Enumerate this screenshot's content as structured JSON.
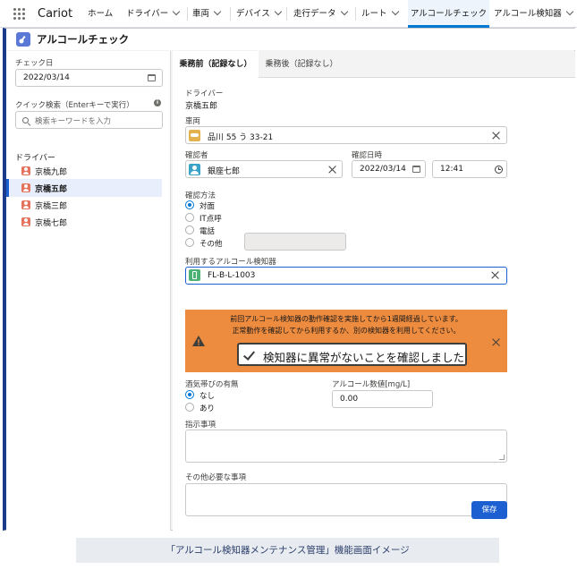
{
  "app": {
    "name": "Cariot"
  },
  "nav": {
    "tabs": [
      {
        "label": "ホーム"
      },
      {
        "label": "ドライバー"
      },
      {
        "label": "車両"
      },
      {
        "label": "デバイス"
      },
      {
        "label": "走行データ"
      },
      {
        "label": "ルート"
      },
      {
        "label": "アルコールチェック"
      },
      {
        "label": "アルコール検知器"
      }
    ],
    "active_tab": "アルコールチェック"
  },
  "page": {
    "title": "アルコールチェック"
  },
  "left": {
    "check_date_label": "チェック日",
    "check_date_value": "2022/03/14",
    "quick_search_label": "クイック検索（Enterキーで実行）",
    "search_placeholder": "検索キーワードを入力",
    "drivers_label": "ドライバー",
    "drivers": [
      {
        "name": "京橋九郎",
        "selected": false
      },
      {
        "name": "京橋五郎",
        "selected": true
      },
      {
        "name": "京橋三郎",
        "selected": false
      },
      {
        "name": "京橋七郎",
        "selected": false
      }
    ]
  },
  "main": {
    "tabs": [
      {
        "label": "乗務前（記録なし）",
        "active": true
      },
      {
        "label": "乗務後（記録なし）",
        "active": false
      }
    ],
    "driver_label": "ドライバー",
    "driver_value": "京橋五郎",
    "vehicle_label": "車両",
    "vehicle_value": "品川 55 う 33-21",
    "confirmer_label": "確認者",
    "confirmer_value": "銀座七郎",
    "confirm_datetime_label": "確認日時",
    "confirm_date": "2022/03/14",
    "confirm_time": "12:41",
    "method_label": "確認方法",
    "methods": [
      {
        "label": "対面",
        "checked": true
      },
      {
        "label": "IT点呼",
        "checked": false
      },
      {
        "label": "電話",
        "checked": false
      },
      {
        "label": "その他",
        "checked": false
      }
    ],
    "detector_label": "利用するアルコール検知器",
    "detector_value": "FL-B-L-1003",
    "warning": {
      "line1": "前回アルコール検知器の動作確認を実施してから1週間経過しています。",
      "line2": "正常動作を確認してから利用するか、別の検知器を利用してください。",
      "confirm_button": "検知器に異常がないことを確認しました"
    },
    "drunk_label": "酒気帯びの有無",
    "drunk_options": [
      {
        "label": "なし",
        "checked": true
      },
      {
        "label": "あり",
        "checked": false
      }
    ],
    "alcohol_value_label": "アルコール数値[mg/L]",
    "alcohol_value": "0.00",
    "instructions_label": "指示事項",
    "other_label": "その他必要な事項",
    "save_label": "保存"
  },
  "caption": "「アルコール検知器メンテナンス管理」機能画面イメージ",
  "colors": {
    "accent": "#1b5fd1",
    "warning": "#ed8b3f",
    "frame_left": "#1b3a8a",
    "caption_bg": "#e8ecf1"
  }
}
